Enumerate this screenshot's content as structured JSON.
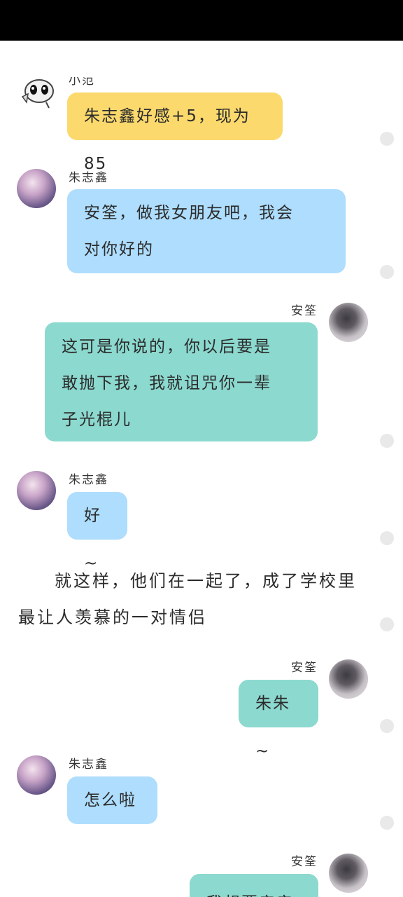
{
  "messages": [
    {
      "sender": "小范",
      "text": "朱志鑫好感+5，现为85"
    },
    {
      "sender": "朱志鑫",
      "text": "安筌，做我女朋友吧，我会\n对你好的"
    },
    {
      "sender": "安筌",
      "text": "这可是你说的，你以后要是\n敢抛下我，我就诅咒你一辈\n子光棍儿"
    },
    {
      "sender": "朱志鑫",
      "text": "好~"
    },
    {
      "narration": "就这样，他们在一起了，成了学校里最让人羡慕的一对情侣"
    },
    {
      "sender": "安筌",
      "text": "朱朱~"
    },
    {
      "sender": "朱志鑫",
      "text": "怎么啦"
    },
    {
      "sender": "安筌",
      "text": "我想要亲亲"
    }
  ],
  "icons": {
    "system_avatar": "cartoon-face-icon",
    "more_dot": "dot-icon"
  },
  "colors": {
    "system_bubble": "#fbd96d",
    "boy_bubble": "#aeddfd",
    "girl_bubble": "#8cd9cf",
    "top_bar": "#000000"
  }
}
